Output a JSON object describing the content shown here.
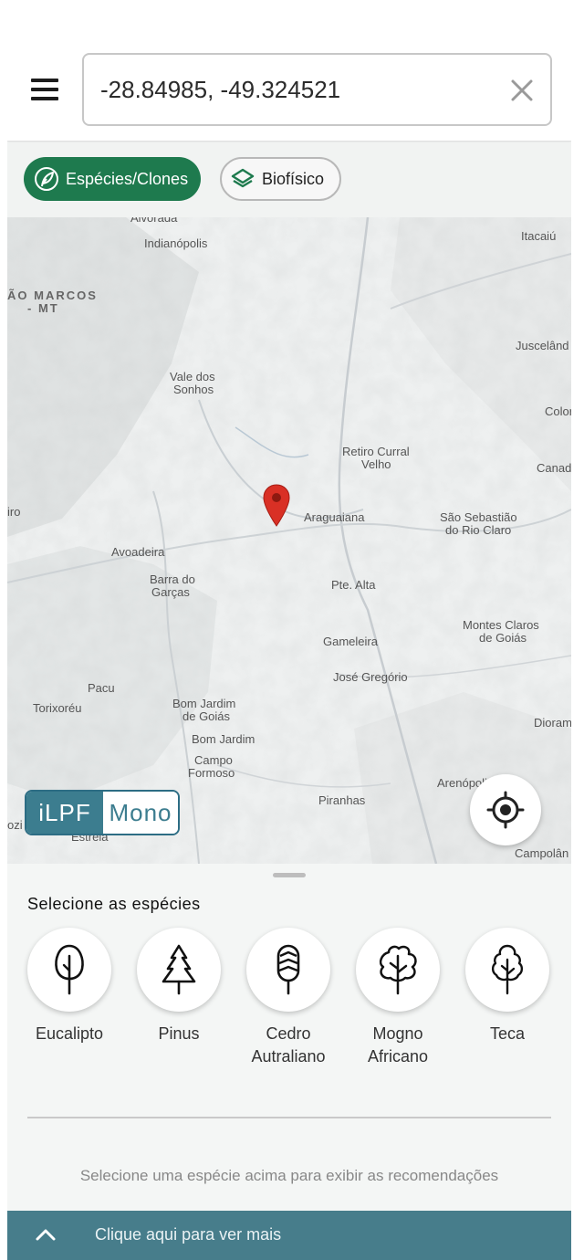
{
  "header": {
    "menu_icon": "hamburger-menu-icon",
    "search_value": "-28.84985, -49.324521",
    "clear_icon": "close-icon"
  },
  "chips": [
    {
      "label": "Espécies/Clones",
      "icon": "leaf-icon",
      "active": true
    },
    {
      "label": "Biofísico",
      "icon": "layers-icon",
      "active": false
    }
  ],
  "map": {
    "labels": {
      "indianopolis": "Indianópolis",
      "itacaiu": "Itacaiú",
      "sao_marcos_1": "ÃO MARCOS",
      "sao_marcos_2": "- MT",
      "juscelandia": "Juscelând",
      "vale_1": "Vale dos",
      "vale_2": "Sonhos",
      "colorado": "Color",
      "retiro_1": "Retiro Curral",
      "retiro_2": "Velho",
      "canad": "Canad",
      "iro": "iro",
      "araguaiana": "Araguaiana",
      "sao_seb_1": "São Sebastião",
      "sao_seb_2": "do Rio Claro",
      "avoadeira": "Avoadeira",
      "barra_1": "Barra do",
      "barra_2": "Garças",
      "pte_alta": "Pte. Alta",
      "montes_1": "Montes Claros",
      "montes_2": "de Goiás",
      "gameleira": "Gameleira",
      "jose_gregorio": "José Gregório",
      "pacu": "Pacu",
      "torixoreu": "Torixoréu",
      "bom_jardim_go_1": "Bom Jardim",
      "bom_jardim_go_2": "de Goiás",
      "bom_jardim": "Bom Jardim",
      "diorama": "Dioram",
      "campo_1": "Campo",
      "campo_2": "Formoso",
      "arenopolis": "Arenópolis",
      "piranhas": "Piranhas",
      "ozi": "ozi",
      "estrela": "Estrela",
      "campolandia": "Campolân",
      "top_partial": "Alvorada"
    },
    "pin_icon": "map-pin-icon",
    "pin_color": "#d93025",
    "locate_icon": "my-location-icon",
    "toggle": {
      "option_a": "iLPF",
      "option_b": "Mono",
      "selected": "iLPF"
    }
  },
  "sheet": {
    "title": "Selecione as espécies",
    "species": [
      {
        "icon": "eucalyptus-tree-icon",
        "line1": "Eucalipto",
        "line2": ""
      },
      {
        "icon": "pine-tree-icon",
        "line1": "Pinus",
        "line2": ""
      },
      {
        "icon": "cedar-tree-icon",
        "line1": "Cedro",
        "line2": "Autraliano"
      },
      {
        "icon": "mahogany-tree-icon",
        "line1": "Mogno",
        "line2": "Africano"
      },
      {
        "icon": "teak-tree-icon",
        "line1": "Teca",
        "line2": ""
      }
    ],
    "hint": "Selecione uma espécie acima para exibir as recomendações"
  },
  "bottom_bar": {
    "label": "Clique aqui para ver mais",
    "icon": "chevron-up-icon"
  },
  "colors": {
    "primary_green": "#1e7a4e",
    "teal": "#477d8b",
    "toggle_teal": "#3c7d8f"
  }
}
